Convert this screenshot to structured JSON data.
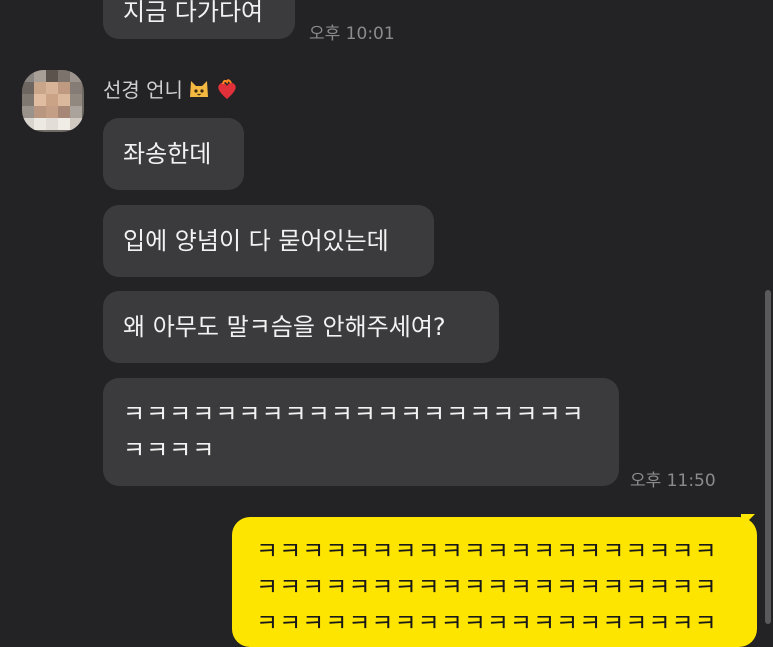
{
  "messages": {
    "prev_incoming": {
      "text": "지금 다가다여",
      "time": "오후 10:01"
    },
    "sender": {
      "name": "선경 언니"
    },
    "incoming": [
      {
        "text": "좌송한데"
      },
      {
        "text": "입에 양념이 다 묻어있는데"
      },
      {
        "text": "왜 아무도 말ㅋ슴을 안해주세여?"
      },
      {
        "line1": "ㅋㅋㅋㅋㅋㅋㅋㅋㅋㅋㅋㅋㅋㅋㅋㅋㅋㅋㅋㅋ",
        "line2": "ㅋㅋㅋㅋ",
        "time": "오후 11:50"
      }
    ],
    "outgoing": {
      "line1": "ㅋㅋㅋㅋㅋㅋㅋㅋㅋㅋㅋㅋㅋㅋㅋㅋㅋㅋㅋㅋ",
      "line2": "ㅋㅋㅋㅋㅋㅋㅋㅋㅋㅋㅋㅋㅋㅋㅋㅋㅋㅋㅋㅋ",
      "line3": "ㅋㅋㅋㅋㅋㅋㅋㅋㅋㅋㅋㅋㅋㅋㅋㅋㅋㅋㅋㅋ"
    }
  },
  "icons": {
    "cat": "cat-face-emoji",
    "heart": "heart-on-fire-emoji",
    "avatar": "blurred-profile-photo"
  },
  "colors": {
    "background": "#232326",
    "incoming_bubble": "#3b3b3d",
    "outgoing_bubble": "#fee500",
    "timestamp": "#8b8b8e"
  }
}
